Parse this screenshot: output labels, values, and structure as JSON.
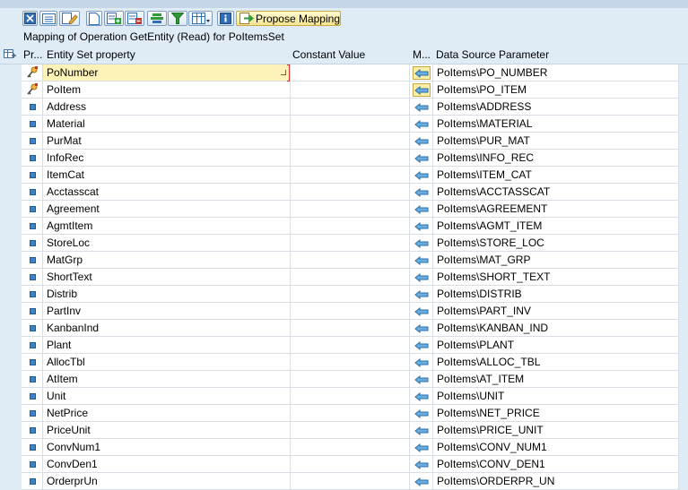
{
  "toolbar": {
    "buttons": [
      {
        "name": "select-all-icon"
      },
      {
        "name": "details-icon"
      },
      {
        "name": "edit-icon"
      },
      {
        "name": "new-doc-icon"
      },
      {
        "name": "insert-row-icon"
      },
      {
        "name": "delete-row-icon"
      },
      {
        "name": "align-icon"
      },
      {
        "name": "filter-icon"
      },
      {
        "name": "layout-icon"
      },
      {
        "name": "info-icon"
      }
    ],
    "propose_label": "Propose Mapping"
  },
  "title": "Mapping of Operation GetEntity (Read) for PoItemsSet",
  "columns": {
    "pr": "Pr...",
    "prop": "Entity Set property",
    "const": "Constant Value",
    "m": "M...",
    "src": "Data Source Parameter"
  },
  "rows": [
    {
      "prop": "PoNumber",
      "src": "PoItems\\PO_NUMBER",
      "key": true
    },
    {
      "prop": "PoItem",
      "src": "PoItems\\PO_ITEM",
      "key": true
    },
    {
      "prop": "Address",
      "src": "PoItems\\ADDRESS",
      "key": false
    },
    {
      "prop": "Material",
      "src": "PoItems\\MATERIAL",
      "key": false
    },
    {
      "prop": "PurMat",
      "src": "PoItems\\PUR_MAT",
      "key": false
    },
    {
      "prop": "InfoRec",
      "src": "PoItems\\INFO_REC",
      "key": false
    },
    {
      "prop": "ItemCat",
      "src": "PoItems\\ITEM_CAT",
      "key": false
    },
    {
      "prop": "Acctasscat",
      "src": "PoItems\\ACCTASSCAT",
      "key": false
    },
    {
      "prop": "Agreement",
      "src": "PoItems\\AGREEMENT",
      "key": false
    },
    {
      "prop": "AgmtItem",
      "src": "PoItems\\AGMT_ITEM",
      "key": false
    },
    {
      "prop": "StoreLoc",
      "src": "PoItems\\STORE_LOC",
      "key": false
    },
    {
      "prop": "MatGrp",
      "src": "PoItems\\MAT_GRP",
      "key": false
    },
    {
      "prop": "ShortText",
      "src": "PoItems\\SHORT_TEXT",
      "key": false
    },
    {
      "prop": "Distrib",
      "src": "PoItems\\DISTRIB",
      "key": false
    },
    {
      "prop": "PartInv",
      "src": "PoItems\\PART_INV",
      "key": false
    },
    {
      "prop": "KanbanInd",
      "src": "PoItems\\KANBAN_IND",
      "key": false
    },
    {
      "prop": "Plant",
      "src": "PoItems\\PLANT",
      "key": false
    },
    {
      "prop": "AllocTbl",
      "src": "PoItems\\ALLOC_TBL",
      "key": false
    },
    {
      "prop": "AtItem",
      "src": "PoItems\\AT_ITEM",
      "key": false
    },
    {
      "prop": "Unit",
      "src": "PoItems\\UNIT",
      "key": false
    },
    {
      "prop": "NetPrice",
      "src": "PoItems\\NET_PRICE",
      "key": false
    },
    {
      "prop": "PriceUnit",
      "src": "PoItems\\PRICE_UNIT",
      "key": false
    },
    {
      "prop": "ConvNum1",
      "src": "PoItems\\CONV_NUM1",
      "key": false
    },
    {
      "prop": "ConvDen1",
      "src": "PoItems\\CONV_DEN1",
      "key": false
    },
    {
      "prop": "OrderprUn",
      "src": "PoItems\\ORDERPR_UN",
      "key": false
    }
  ]
}
